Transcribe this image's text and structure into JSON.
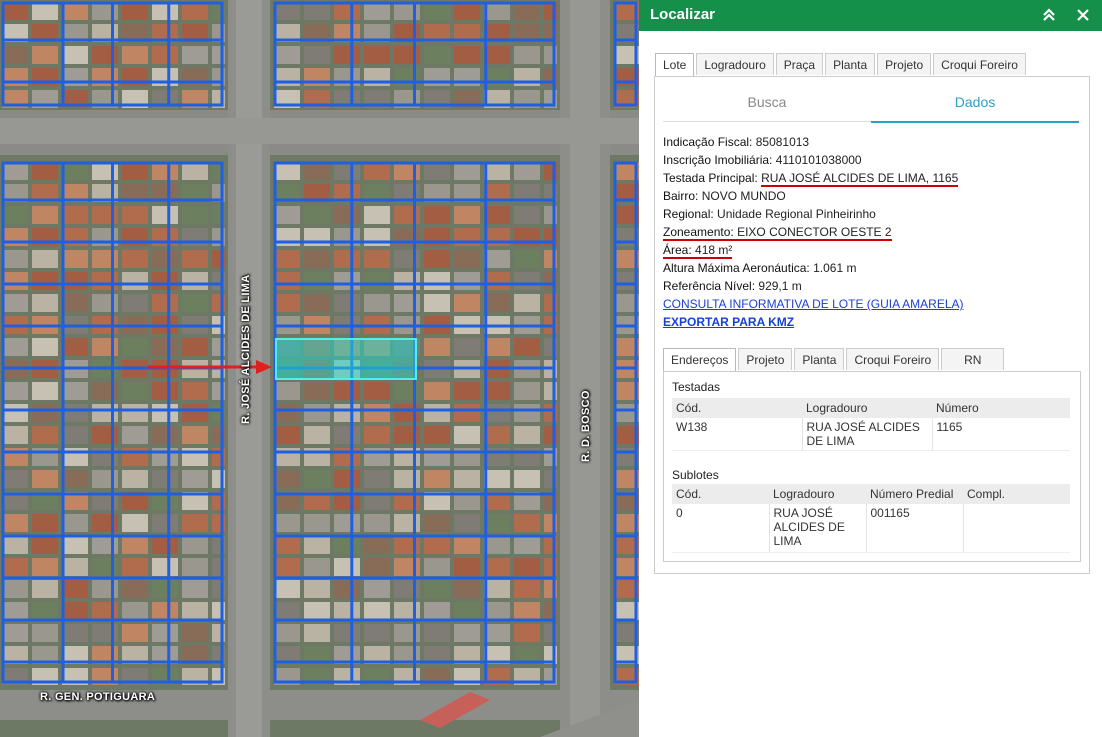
{
  "map": {
    "streets": {
      "left_vertical": "R. JOSÉ ALCIDES DE LIMA",
      "right_vertical": "R. D. BOSCO",
      "bottom": "R. GEN. POTIGUARA"
    },
    "colors": {
      "parcel_line": "#1f5fe0",
      "highlight": "#27d6c8",
      "arrow": "#e02020"
    }
  },
  "panel": {
    "title": "Localizar",
    "collapse_icon": "double-chevron-up-icon",
    "close_icon": "close-icon",
    "tabs": [
      {
        "label": "Lote",
        "active": true
      },
      {
        "label": "Logradouro"
      },
      {
        "label": "Praça"
      },
      {
        "label": "Planta"
      },
      {
        "label": "Projeto"
      },
      {
        "label": "Croqui Foreiro"
      }
    ],
    "subtabs": {
      "busca": "Busca",
      "dados": "Dados"
    },
    "info": {
      "indicacao_label": "Indicação Fiscal:",
      "indicacao_value": "85081013",
      "inscricao_label": "Inscrição Imobiliária:",
      "inscricao_value": "4110101038000",
      "testada_label": "Testada Principal:",
      "testada_value": "RUA JOSÉ ALCIDES DE LIMA, 1165",
      "bairro_label": "Bairro:",
      "bairro_value": "NOVO MUNDO",
      "regional_label": "Regional:",
      "regional_value": "Unidade Regional Pinheirinho",
      "zoneamento_label": "Zoneamento:",
      "zoneamento_value": "EIXO CONECTOR OESTE 2",
      "area_label": "Área:",
      "area_value": "418 m²",
      "altura_label": "Altura Máxima Aeronáutica:",
      "altura_value": "1.061 m",
      "referencia_label": "Referência Nível:",
      "referencia_value": "929,1 m",
      "consulta_link": "CONSULTA INFORMATIVA DE LOTE (GUIA AMARELA)",
      "exportar_link": "EXPORTAR PARA KMZ"
    },
    "inner_tabs": [
      {
        "label": "Endereços",
        "active": true
      },
      {
        "label": "Projeto"
      },
      {
        "label": "Planta"
      },
      {
        "label": "Croqui Foreiro"
      },
      {
        "label": "RN"
      }
    ],
    "testadas": {
      "title": "Testadas",
      "headers": [
        "Cód.",
        "Logradouro",
        "Número"
      ],
      "rows": [
        [
          "W138",
          "RUA JOSÉ ALCIDES DE LIMA",
          "1165"
        ]
      ]
    },
    "sublotes": {
      "title": "Sublotes",
      "headers": [
        "Cód.",
        "Logradouro",
        "Número Predial",
        "Compl."
      ],
      "rows": [
        [
          "0",
          "RUA JOSÉ ALCIDES DE LIMA",
          "001165",
          ""
        ]
      ]
    }
  }
}
